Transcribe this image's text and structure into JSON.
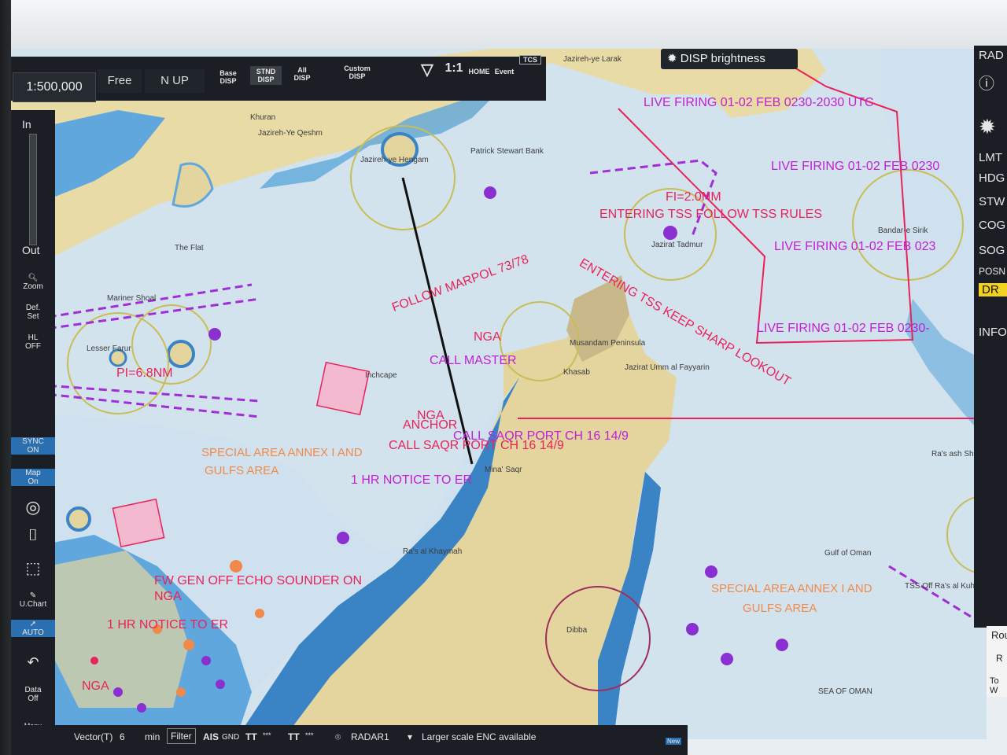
{
  "toolbar": {
    "scale": "1:500,000",
    "mode": "Free",
    "orientation": "N UP",
    "display_buttons": [
      "Base\nDISP",
      "STND\nDISP",
      "All\nDISP",
      "Custom\nDISP"
    ],
    "ratio": "1:1",
    "home": "HOME",
    "event": "Event",
    "tcs": "TCS",
    "disp_brightness": "DISP brightness"
  },
  "left_tools": {
    "zoom_in": "In",
    "zoom_out": "Out",
    "zoom": "Zoom",
    "def_set": "Def.\nSet",
    "hl_off": "HL\nOFF",
    "sync_on": "SYNC\nON",
    "map_on": "Map\nOn",
    "u_chart": "U.Chart",
    "auto": "AUTO",
    "data_off": "Data\nOff",
    "menu": "Menu"
  },
  "right_panel": [
    "RAD",
    "LMT",
    "HDG",
    "STW",
    "COG",
    "SOG",
    "POSN",
    "DR",
    "INFO",
    "Rou",
    "R",
    "To W"
  ],
  "bottom_bar": {
    "vector_label": "Vector(T)",
    "vector_value": "6",
    "vector_unit": "min",
    "filter": "Filter",
    "ais": "AIS",
    "gnd": "GND",
    "tt1": "TT",
    "tt1_stars": "***",
    "tt2": "TT",
    "tt2_stars": "***",
    "radar": "RADAR1",
    "enc_msg": "Larger scale ENC available",
    "new_badge": "New"
  },
  "annotations": {
    "live_firing_1": "LIVE FIRING 01-02 FEB 0230-2030 UTC",
    "live_firing_2": "LIVE FIRING 01-02 FEB 0230",
    "live_firing_3": "LIVE FIRING 01-02 FEB 023",
    "live_firing_4": "LIVE FIRING 01-02 FEB 0230-",
    "tss_follow": "ENTERING TSS FOLLOW TSS RULES",
    "tss_keep": "ENTERING TSS KEEP SHARP LOOKOUT",
    "fi_2nm": "FI=2.0NM",
    "marpol": "FOLLOW MARPOL 73/78",
    "nga1": "NGA",
    "call_master": "CALL MASTER",
    "nga2": "NGA",
    "anchor": "ANCHOR",
    "call_saqr": "CALL SAQR PORT CH 16 14/9",
    "call_saqr2": "CALL SAQR PORT CH 16 14/9",
    "notice": "1 HR NOTICE TO ER",
    "pi": "PI=6.8NM",
    "fw_gen": "FW GEN OFF ECHO SOUNDER ON",
    "nga3": "NGA",
    "hp_notice": "1 HR NOTICE TO ER",
    "nga4": "NGA",
    "special_area_1": "SPECIAL AREA ANNEX I AND",
    "gulfs_area_1": "GULFS AREA",
    "special_area_2": "SPECIAL AREA ANNEX I AND",
    "gulfs_area_2": "GULFS AREA"
  },
  "places": {
    "khuran": "Khuran",
    "qeshm": "Jazireh-Ye Qeshm",
    "hengam": "Jazireh-ye Hengam",
    "patrick": "Patrick Stewart Bank",
    "the_flat": "The Flat",
    "tadmur": "Jazirat Tadmur",
    "musandam": "Musandam Peninsula",
    "khasab": "Khasab",
    "fayyarin": "Jazirat Umm al Fayyarin",
    "mina_saqr": "Mina' Saqr",
    "ras_khaymah": "Ra's al Khaymah",
    "gulf_oman": "Gulf of Oman",
    "sea_oman": "SEA OF OMAN",
    "bandar_sirik": "Bandar-e Sirik",
    "ras_shir": "Ra's ash Shir",
    "dibba": "Dibba",
    "jazirat_laral": "Jazireh-ye Larak",
    "lesser_farur": "Lesser Farur",
    "mariner_shoal": "Mariner Shoal",
    "inchcape": "Inchcape",
    "ras_kuh": "TSS Off Ra's al Kuh",
    "ras_al": "Ra's al"
  },
  "colors": {
    "land": "#e4d59f",
    "deep_water": "#cfe0ec",
    "shallow_water": "#5fa7dc",
    "route": "#e8235a",
    "firing_area": "#e8235a",
    "restricted": "#a02ed6",
    "waypoint_ring": "#c9bd55",
    "toolbar_bg": "#1b1f25",
    "accent_blue": "#2a6fb0"
  }
}
